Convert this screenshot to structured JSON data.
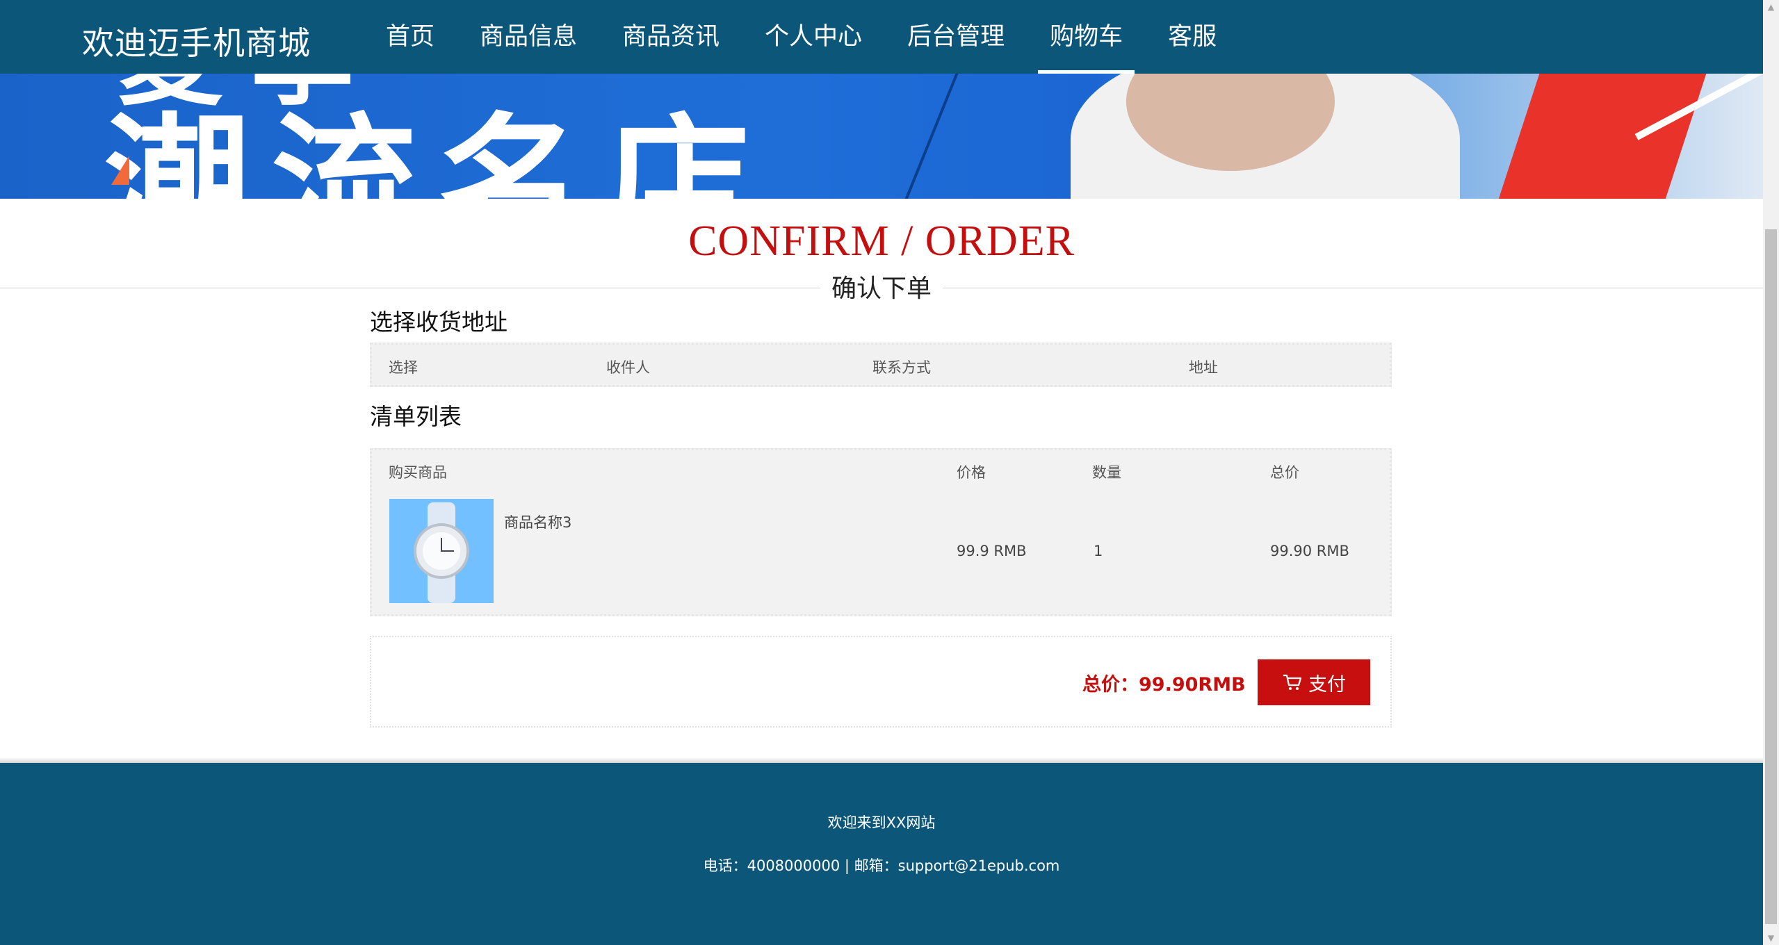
{
  "header": {
    "logo": "欢迪迈手机商城",
    "nav": [
      "首页",
      "商品信息",
      "商品资讯",
      "个人中心",
      "后台管理",
      "购物车",
      "客服"
    ],
    "active_nav": "购物车"
  },
  "banner": {
    "text": "潮流名店"
  },
  "page_title": {
    "en": "CONFIRM / ORDER",
    "cn": "确认下单"
  },
  "address_section": {
    "title": "选择收货地址",
    "headers": [
      "选择",
      "收件人",
      "联系方式",
      "地址"
    ]
  },
  "list_section": {
    "title": "清单列表",
    "headers": [
      "购买商品",
      "价格",
      "数量",
      "总价"
    ],
    "items": [
      {
        "name": "商品名称3",
        "price": "99.9 RMB",
        "quantity": "1",
        "total": "99.90 RMB"
      }
    ]
  },
  "order_total": {
    "label": "总价：99.90RMB",
    "pay_button": "支付"
  },
  "footer": {
    "line1": "欢迎来到XX网站",
    "line2": "电话：4008000000 | 邮箱：support@21epub.com"
  },
  "colors": {
    "header_bg": "#0c5779",
    "accent_red": "#c40f0f",
    "table_bg": "#f2f2f2"
  }
}
